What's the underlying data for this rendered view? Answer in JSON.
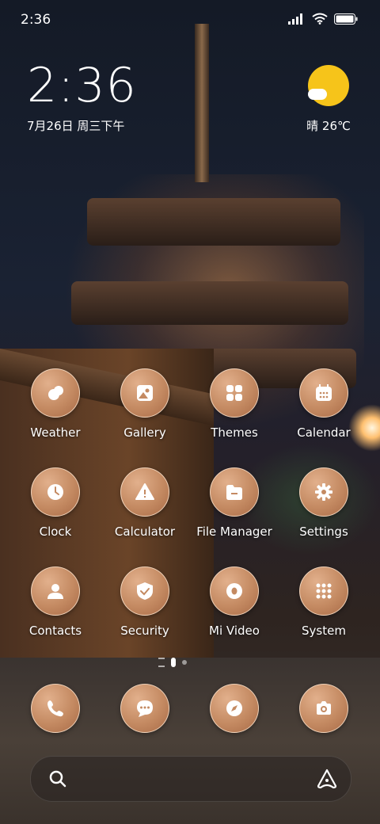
{
  "status_bar": {
    "time": "2:36"
  },
  "clock_widget": {
    "time": "2:36",
    "date": "7月26日 周三下午"
  },
  "weather_widget": {
    "text": "晴 26℃"
  },
  "apps": [
    {
      "label": "Weather",
      "icon": "weather-icon"
    },
    {
      "label": "Gallery",
      "icon": "gallery-icon"
    },
    {
      "label": "Themes",
      "icon": "themes-icon"
    },
    {
      "label": "Calendar",
      "icon": "calendar-icon"
    },
    {
      "label": "Clock",
      "icon": "clock-icon"
    },
    {
      "label": "Calculator",
      "icon": "calculator-icon"
    },
    {
      "label": "File Manager",
      "icon": "folder-icon"
    },
    {
      "label": "Settings",
      "icon": "gear-icon"
    },
    {
      "label": "Contacts",
      "icon": "contacts-icon"
    },
    {
      "label": "Security",
      "icon": "shield-icon"
    },
    {
      "label": "Mi Video",
      "icon": "video-icon"
    },
    {
      "label": "System",
      "icon": "folder-grid-icon"
    }
  ],
  "dock": [
    {
      "icon": "phone-icon"
    },
    {
      "icon": "message-icon"
    },
    {
      "icon": "compass-icon"
    },
    {
      "icon": "camera-icon"
    }
  ],
  "icon_color": "#c48a62",
  "accent_sun": "#f6c41a"
}
